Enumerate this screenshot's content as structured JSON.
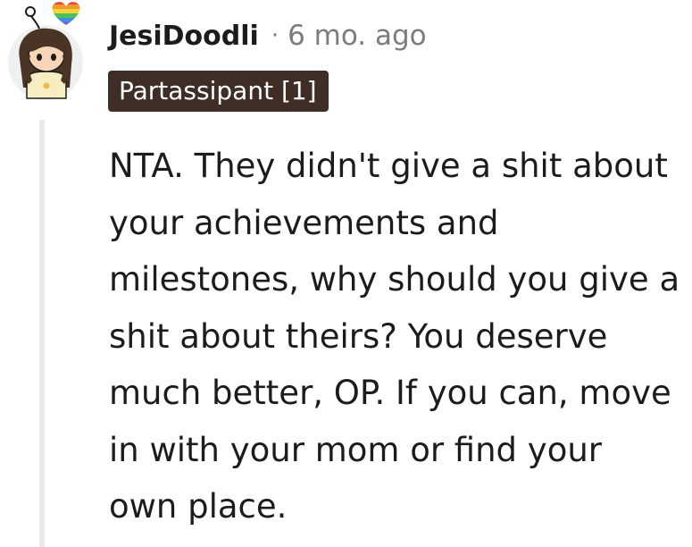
{
  "comment": {
    "author": "JesiDoodli",
    "separator": "·",
    "timestamp": "6 mo. ago",
    "flair": "Partassipant [1]",
    "body": "NTA. They didn't give a shit about your achievements and milestones, why should you give a shit about theirs? You deserve much better, OP. If you can, move in with your mom or find your own place."
  },
  "icons": {
    "avatar": "user-avatar-girl-with-rainbow-heart",
    "thread_line": "thread-collapse-line"
  }
}
